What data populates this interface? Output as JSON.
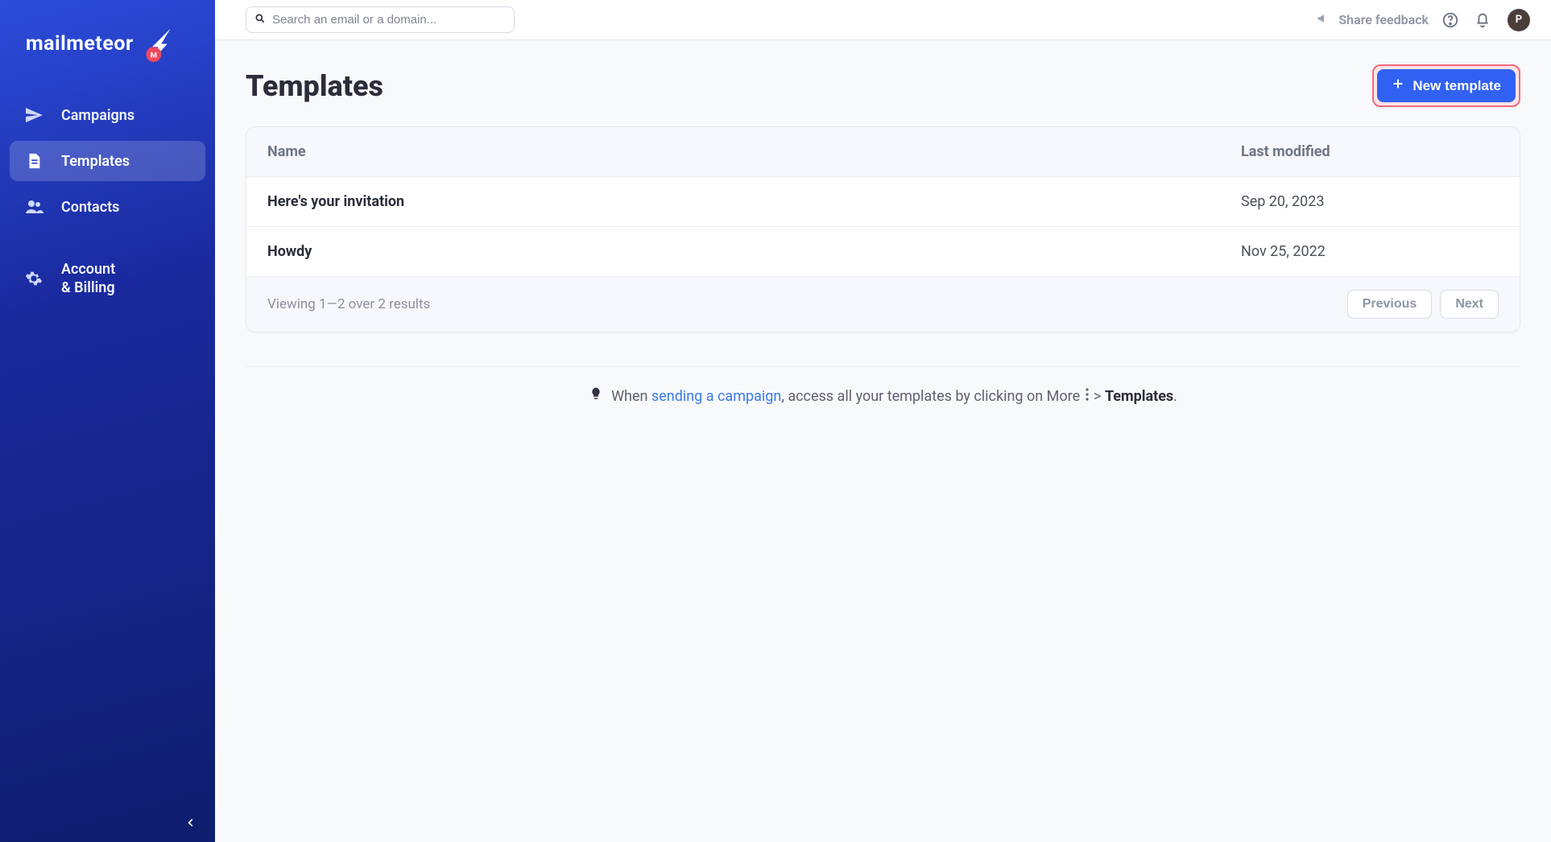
{
  "brand": {
    "name": "mailmeteor"
  },
  "search": {
    "placeholder": "Search an email or a domain..."
  },
  "topbar": {
    "share_label": "Share feedback",
    "avatar_initial": "P"
  },
  "sidebar": {
    "items": [
      {
        "label": "Campaigns"
      },
      {
        "label": "Templates"
      },
      {
        "label": "Contacts"
      },
      {
        "label_line1": "Account",
        "label_line2": "& Billing"
      }
    ]
  },
  "page": {
    "title": "Templates",
    "new_button": "New template"
  },
  "table": {
    "columns": {
      "name": "Name",
      "modified": "Last modified"
    },
    "rows": [
      {
        "name": "Here's your invitation",
        "modified": "Sep 20, 2023"
      },
      {
        "name": "Howdy",
        "modified": "Nov 25, 2022"
      }
    ],
    "footer": {
      "viewing": "Viewing 1—2 over 2 results",
      "previous": "Previous",
      "next": "Next"
    }
  },
  "tip": {
    "prefix": "When ",
    "link": "sending a campaign",
    "mid": ", access all your templates by clicking on More ",
    "arrow_templates": " > ",
    "templates_strong": "Templates",
    "dot": "."
  }
}
